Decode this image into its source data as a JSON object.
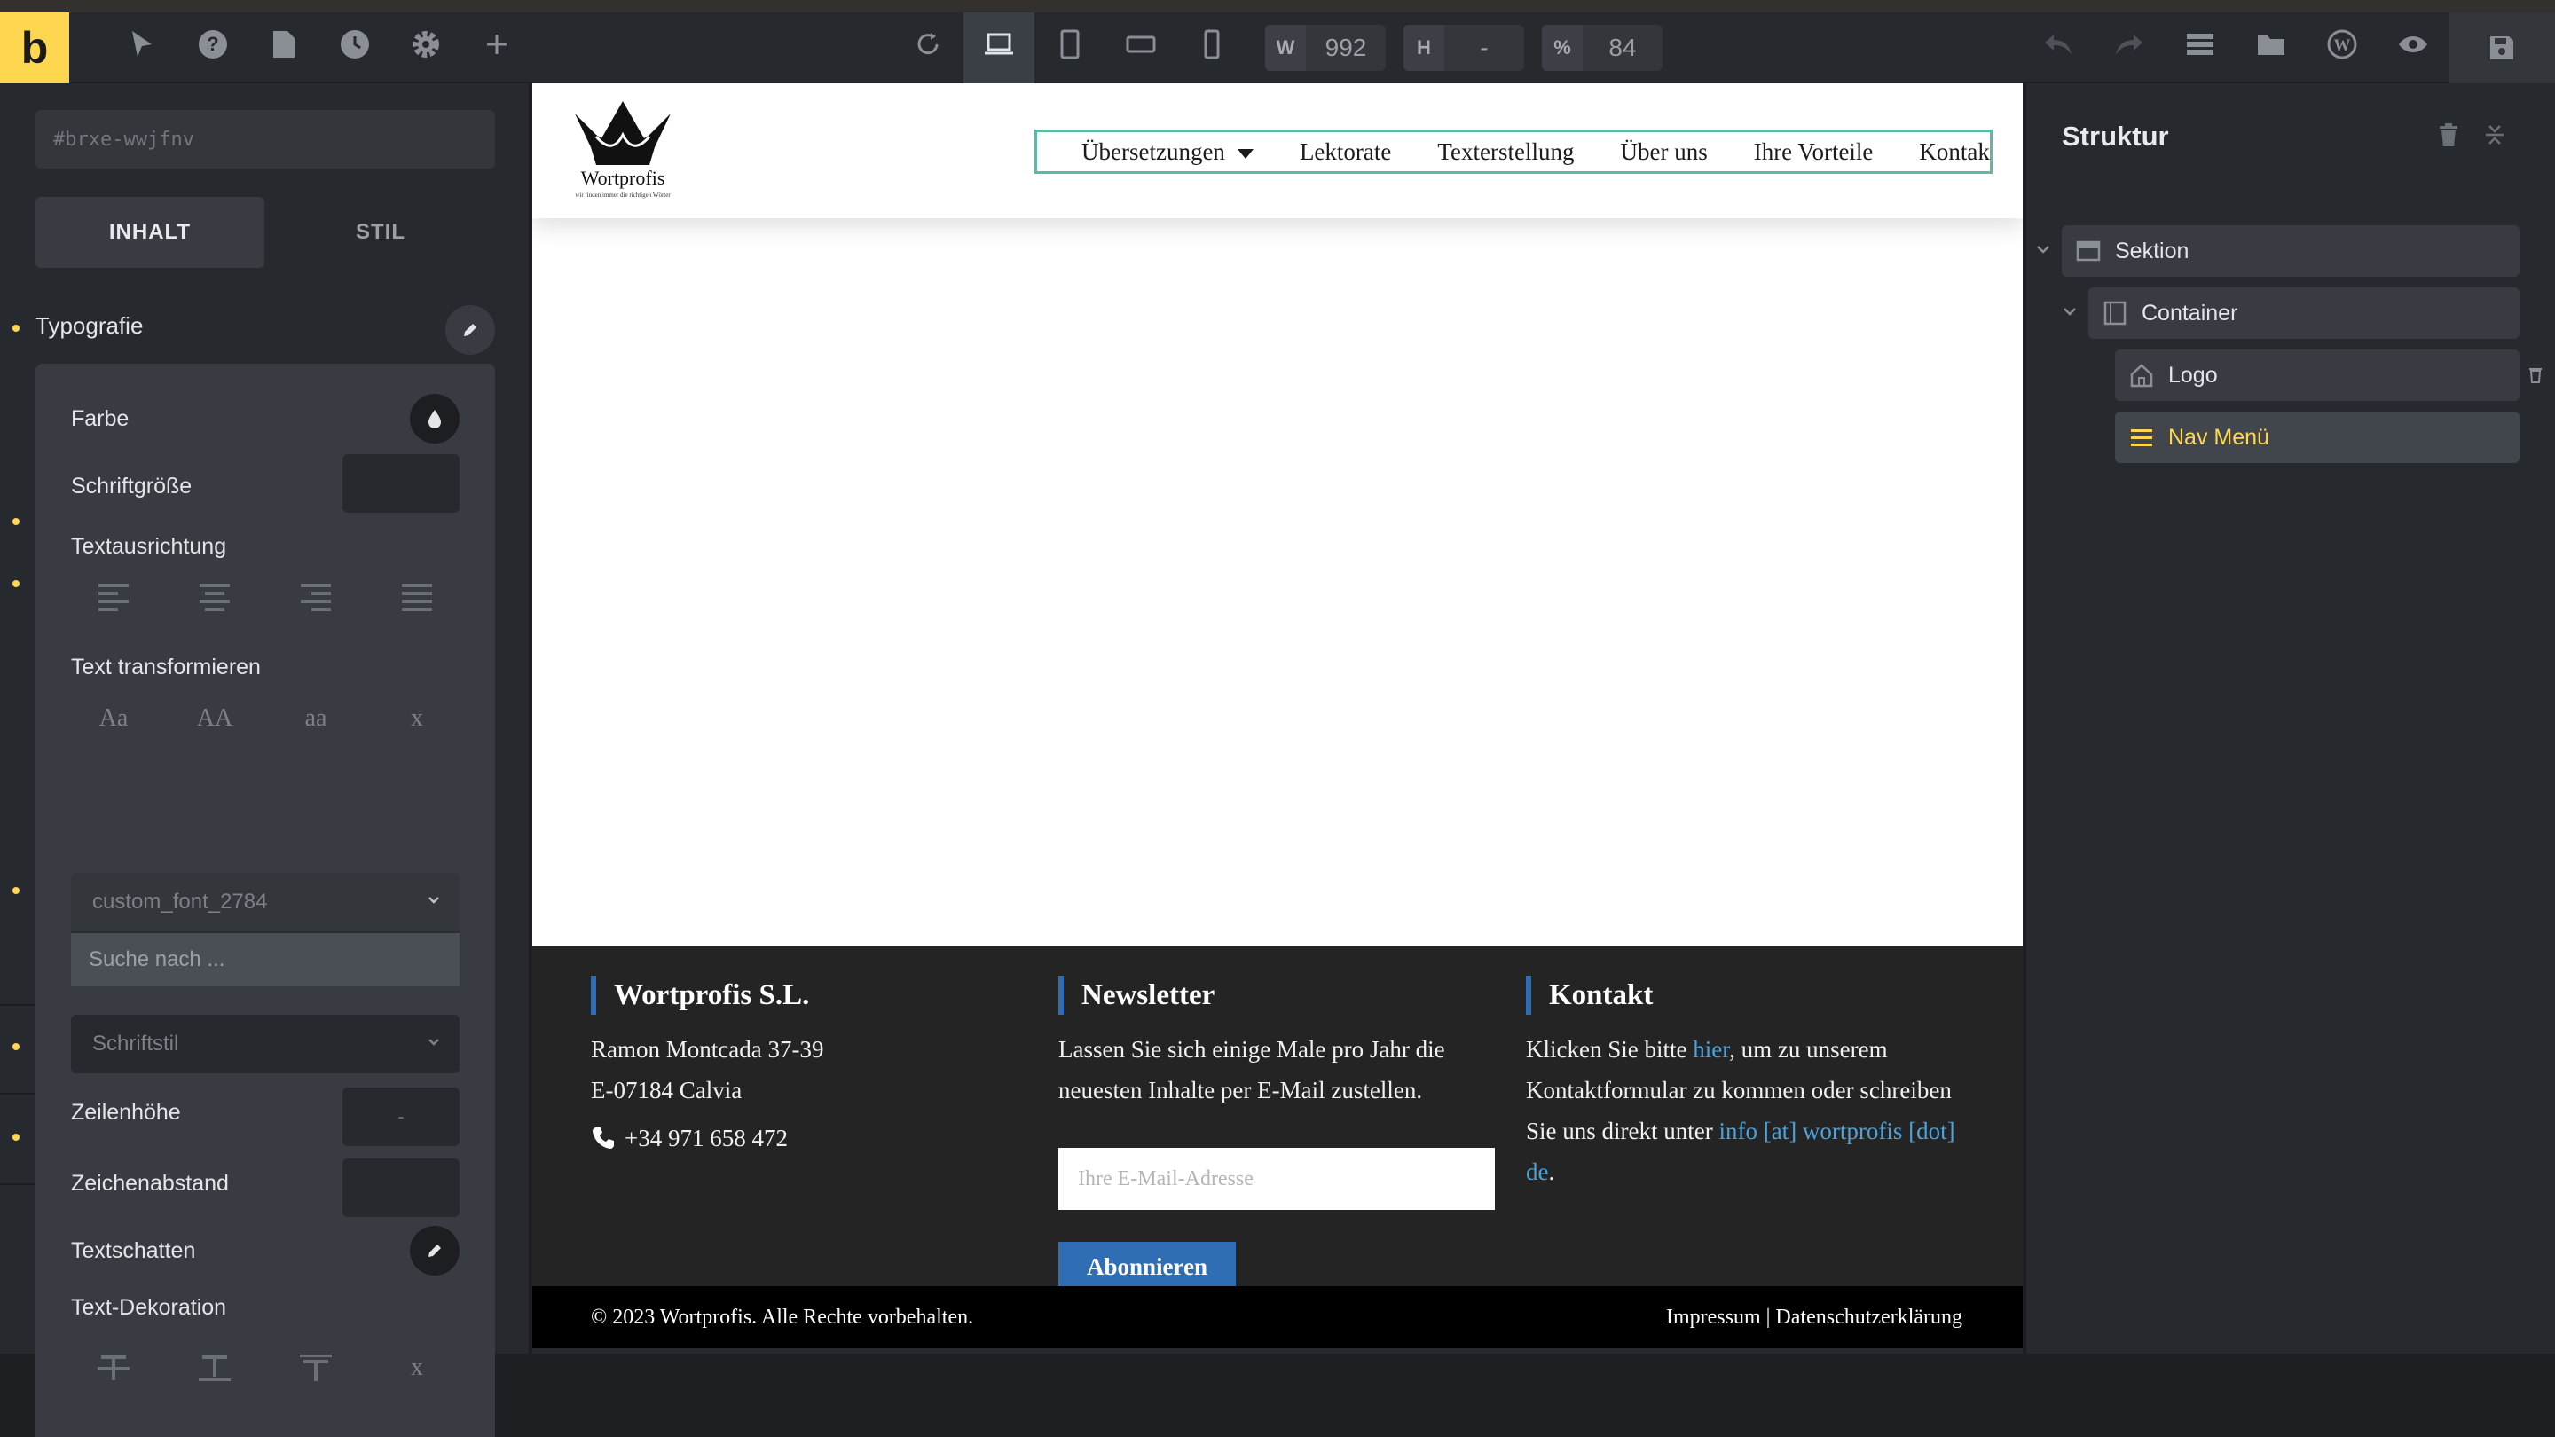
{
  "toolbar": {
    "logo_letter": "b",
    "width_label": "W",
    "width_value": "992",
    "height_label": "H",
    "height_value": "-",
    "zoom_label": "%",
    "zoom_value": "84"
  },
  "left_panel": {
    "element_id_placeholder": "#brxe-wwjfnv",
    "tab_content": "INHALT",
    "tab_style": "STIL",
    "section_typography": "Typografie",
    "color_label": "Farbe",
    "font_size_label": "Schriftgröße",
    "text_align_label": "Textausrichtung",
    "text_transform_label": "Text transformieren",
    "text_transform_options": [
      "Aa",
      "AA",
      "aa",
      "x"
    ],
    "font_family_value": "custom_font_2784",
    "search_placeholder": "Suche nach ...",
    "font_style_placeholder": "Schriftstil",
    "line_height_label": "Zeilenhöhe",
    "line_height_value": "-",
    "letter_spacing_label": "Zeichenabstand",
    "text_shadow_label": "Textschatten",
    "text_decoration_label": "Text-Dekoration",
    "text_decoration_clear": "x"
  },
  "site": {
    "logo_name": "Wortprofis",
    "logo_tagline": "wir finden immer die richtigen Wörter",
    "nav_items": [
      "Übersetzungen",
      "Lektorate",
      "Texterstellung",
      "Über uns",
      "Ihre Vorteile",
      "Kontakt"
    ],
    "footer": {
      "col1_title": "Wortprofis S.L.",
      "col1_address1": "Ramon Montcada 37-39",
      "col1_address2": "E-07184 Calvia",
      "col1_phone": "+34 971 658 472",
      "col2_title": "Newsletter",
      "col2_text": "Lassen Sie sich einige Male pro Jahr die neuesten Inhalte per E-Mail zustellen.",
      "email_placeholder": "Ihre E-Mail-Adresse",
      "subscribe_label": "Abonnieren",
      "col3_title": "Kontakt",
      "col3_text_before": "Klicken Sie bitte ",
      "col3_link1": "hier",
      "col3_text_middle": ", um zu unserem Kontaktformular zu kommen oder schreiben Sie uns direkt unter ",
      "col3_link2": "info [at] wortprofis [dot] de",
      "col3_text_after": "."
    },
    "copyright": "© 2023 Wortprofis. Alle Rechte vorbehalten.",
    "legal_links": "Impressum | Datenschutzerklärung"
  },
  "right_panel": {
    "title": "Struktur",
    "items": [
      {
        "label": "Sektion",
        "icon": "section-icon"
      },
      {
        "label": "Container",
        "icon": "container-icon"
      },
      {
        "label": "Logo",
        "icon": "home-icon"
      },
      {
        "label": "Nav Menü",
        "icon": "menu-icon"
      }
    ]
  },
  "colors": {
    "accent": "#ffd64f",
    "nav_outline": "#5fb8a4",
    "footer_accent": "#2f6db5",
    "link": "#4aa3df"
  }
}
